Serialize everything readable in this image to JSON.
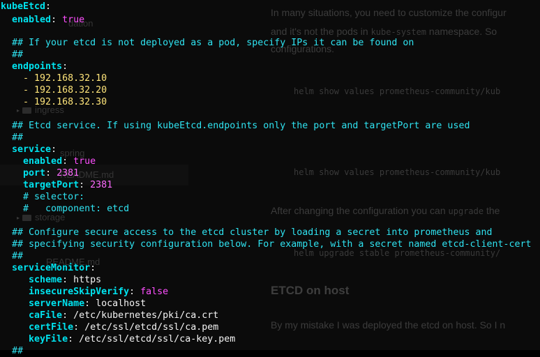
{
  "background_doc": {
    "sidebar": [
      {
        "label": "dation"
      },
      {
        "label": "ingress"
      },
      {
        "label": "spring"
      },
      {
        "label": "README.md"
      },
      {
        "label": "storage"
      },
      {
        "label": "README.md"
      }
    ],
    "paragraph_1_line_1": "In many situations, you need to customize the configur",
    "paragraph_1_line_2_a": "and it's not the pods in ",
    "paragraph_1_line_2_code": "kube-system",
    "paragraph_1_line_2_b": " namespace. So",
    "paragraph_1_line_3": "configurations.",
    "code_1": "helm show values prometheus-community/kub",
    "code_2": "helm show values prometheus-community/kub",
    "paragraph_2_a": "After changing the configuration you can ",
    "paragraph_2_code": "upgrade",
    "paragraph_2_b": " the",
    "code_3": "helm upgrade stable prometheus-community/",
    "heading": "ETCD on host",
    "paragraph_3": "By my mistake I was deployed the etcd on host. So I n"
  },
  "yaml": {
    "root_key": "kubeEtcd",
    "enabled_key": "enabled",
    "enabled_value": "true",
    "comment_1": "## If your etcd is not deployed as a pod, specify IPs it can be found on",
    "comment_hash": "##",
    "endpoints_key": "endpoints",
    "endpoints": [
      "192.168.32.10",
      "192.168.32.20",
      "192.168.32.30"
    ],
    "comment_2": "## Etcd service. If using kubeEtcd.endpoints only the port and targetPort are used",
    "service_key": "service",
    "service_enabled_key": "enabled",
    "service_enabled_value": "true",
    "port_key": "port",
    "port_value": "2381",
    "target_port_key": "targetPort",
    "target_port_value": "2381",
    "selector_comment": "# selector:",
    "component_comment": "#   component: etcd",
    "comment_3": "## Configure secure access to the etcd cluster by loading a secret into prometheus and",
    "comment_4": "## specifying security configuration below. For example, with a secret named etcd-client-cert",
    "service_monitor_key": "serviceMonitor",
    "scheme_key": "scheme",
    "scheme_value": "https",
    "insecure_key": "insecureSkipVerify",
    "insecure_value": "false",
    "server_name_key": "serverName",
    "server_name_value": "localhost",
    "ca_file_key": "caFile",
    "ca_file_value": "/etc/kubernetes/pki/ca.crt",
    "cert_file_key": "certFile",
    "cert_file_value": "/etc/ssl/etcd/ssl/ca.pem",
    "key_file_key": "keyFile",
    "key_file_value": "/etc/ssl/etcd/ssl/ca-key.pem"
  }
}
